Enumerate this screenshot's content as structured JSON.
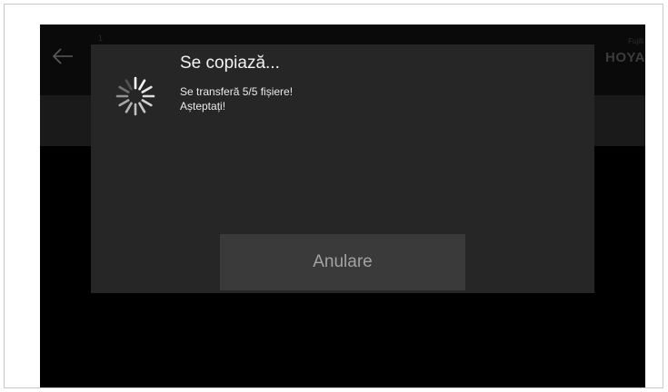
{
  "header": {
    "back_icon": "arrow-left-icon",
    "small_text": "1",
    "brand_top": "Fujifi",
    "brand": "HOYA"
  },
  "dialog": {
    "title": "Se copiază...",
    "message_line1": "Se transferă 5/5 fișiere!",
    "message_line2": "Așteptați!",
    "spinner_icon": "loading-spinner-icon",
    "cancel_label": "Anulare"
  },
  "colors": {
    "screen_background": "#000000",
    "dialog_background": "#262626",
    "button_background": "#3a3a3a",
    "button_text": "#a2a2a2",
    "title_text": "#f2f2f2"
  }
}
